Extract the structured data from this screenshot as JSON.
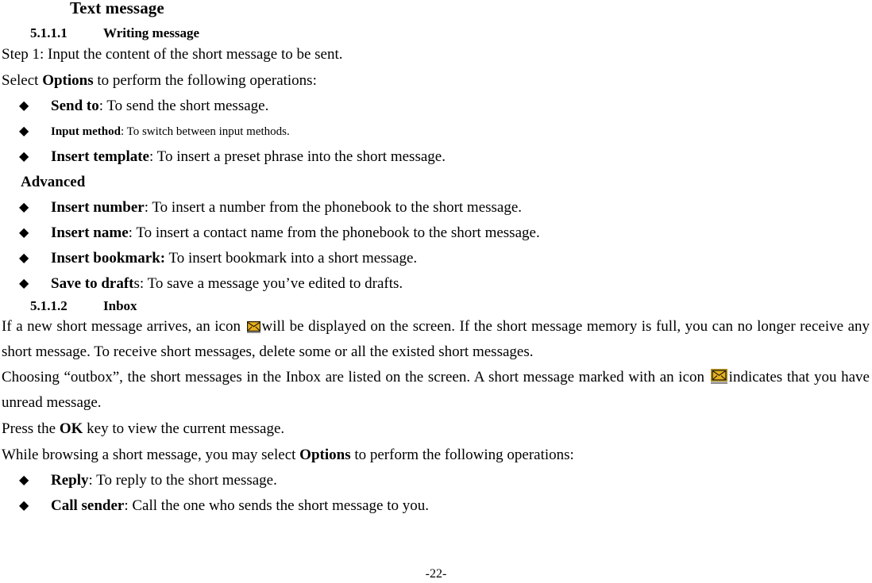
{
  "document": {
    "title": "Text message",
    "footer_page": "-22-"
  },
  "sections": [
    {
      "number": "5.1.1.1",
      "title": "Writing message"
    },
    {
      "number": "5.1.1.2",
      "title": "Inbox"
    }
  ],
  "writing_message": {
    "step1": "Step 1: Input the content of the short message to be sent.",
    "select_line_pre": "Select ",
    "select_line_bold": "Options",
    "select_line_post": " to perform the following operations:",
    "advanced_label": "Advanced",
    "bullets": [
      {
        "marker": "diamond-bullet",
        "term": "Send to",
        "desc": ": To send the short message.",
        "small": false
      },
      {
        "marker": "diamond-bullet",
        "term": "Input method",
        "desc": ": To switch between input methods.",
        "small": true
      },
      {
        "marker": "diamond-bullet",
        "term": "Insert template",
        "desc": ": To insert a preset phrase into the short message.",
        "small": false
      }
    ],
    "bullets_advanced": [
      {
        "marker": "diamond-bullet",
        "term": "Insert number",
        "desc": ": To insert a number from the phonebook to the short message.",
        "small": false
      },
      {
        "marker": "diamond-bullet",
        "term": "Insert name",
        "desc": ": To insert a contact name from the phonebook to the short message.",
        "small": false
      },
      {
        "marker": "diamond-bullet",
        "term": "Insert bookmark:",
        "desc": " To insert bookmark into a short message.",
        "small": false
      },
      {
        "marker": "diamond-bullet",
        "term": "Save to draft",
        "desc": "s: To save a message you’ve edited to drafts.",
        "small": false
      }
    ]
  },
  "inbox": {
    "para1_part1": "If a new short message arrives, an icon ",
    "para1_icon": "envelope-icon",
    "para1_part2": "will be displayed on the screen. If the short message memory is full, you can no longer receive any short message. To receive short messages, delete some or all the existed short messages.",
    "para2_part1": "Choosing “outbox”, the short messages in the Inbox are listed on the screen. A short message marked with an icon ",
    "para2_icon": "envelope-unread-icon",
    "para2_part2": "indicates that you have unread message.",
    "para3_pre": "Press the ",
    "para3_bold": "OK",
    "para3_post": " key to view the current message.",
    "para4_pre": "While browsing a short message, you may select ",
    "para4_bold": "Options",
    "para4_post": " to perform the following operations:",
    "bullets": [
      {
        "marker": "diamond-bullet",
        "term": "Reply",
        "desc": ": To reply to the short message.",
        "small": false
      },
      {
        "marker": "diamond-bullet",
        "term": "Call sender",
        "desc": ": Call the one who sends the short message to you.",
        "small": false
      }
    ]
  },
  "glyphs": {
    "diamond": "◆"
  },
  "colors": {
    "text": "#000000",
    "page_background": "#ffffff",
    "envelope_fill": "#e8b11f",
    "envelope_highlight": "#f6d65e",
    "envelope_outline": "#201a06",
    "envelope_frame": "#8e8e8e"
  }
}
